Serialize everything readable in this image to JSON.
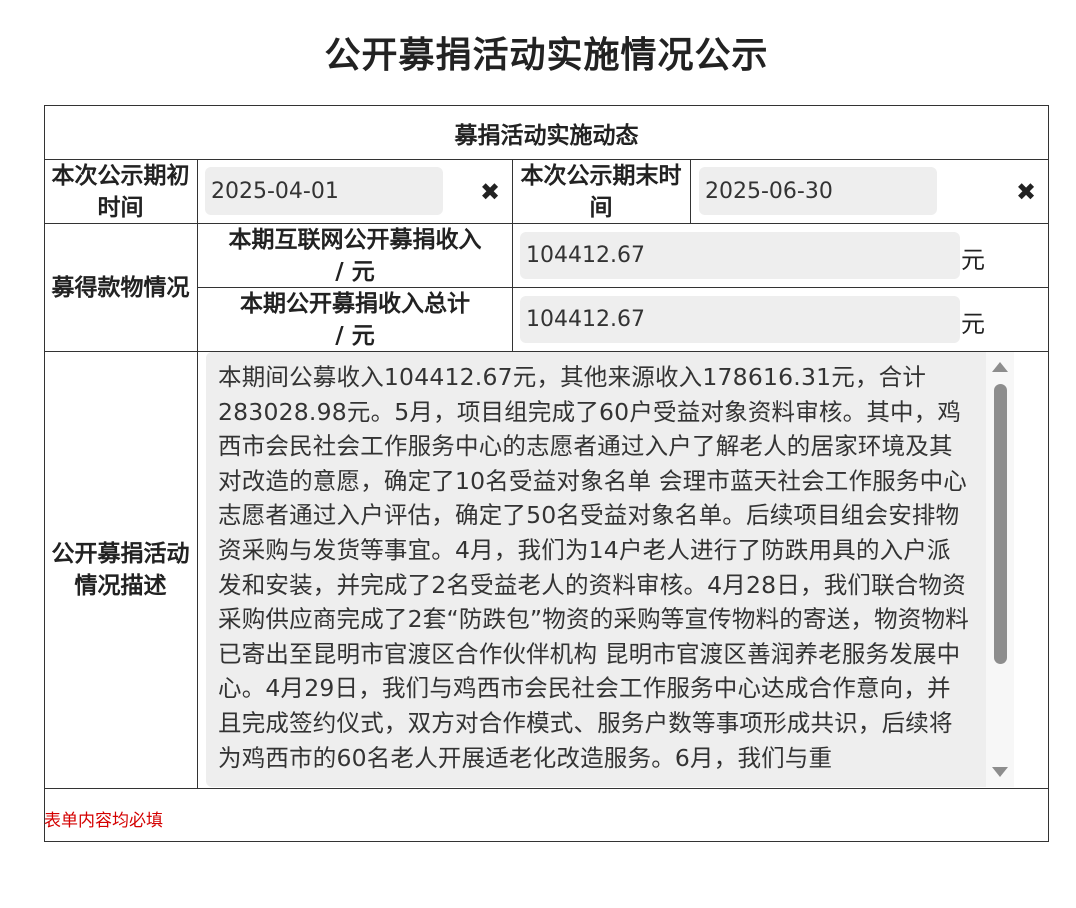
{
  "page": {
    "title": "公开募捐活动实施情况公示"
  },
  "section": {
    "header": "募捐活动实施动态"
  },
  "period": {
    "start_label": "本次公示期初时间",
    "start_value": "2025-04-01",
    "end_label": "本次公示期末时间",
    "end_value": "2025-06-30"
  },
  "funds": {
    "group_label": "募得款物情况",
    "internet_label": "本期互联网公开募捐收入 / 元",
    "internet_value": "104412.67",
    "total_label": "本期公开募捐收入总计 / 元",
    "total_value": "104412.67",
    "unit": "元"
  },
  "description": {
    "label": "公开募捐活动情况描述",
    "text": "本期间公募收入104412.67元，其他来源收入178616.31元，合计283028.98元。5月，项目组完成了60户受益对象资料审核。其中，鸡西市会民社会工作服务中心的志愿者通过入户了解老人的居家环境及其对改造的意愿，确定了10名受益对象名单 会理市蓝天社会工作服务中心志愿者通过入户评估，确定了50名受益对象名单。后续项目组会安排物资采购与发货等事宜。4月，我们为14户老人进行了防跌用具的入户派发和安装，并完成了2名受益老人的资料审核。4月28日，我们联合物资采购供应商完成了2套“防跌包”物资的采购等宣传物料的寄送，物资物料已寄出至昆明市官渡区合作伙伴机构 昆明市官渡区善润养老服务发展中心。4月29日，我们与鸡西市会民社会工作服务中心达成合作意向，并且完成签约仪式，双方对合作模式、服务户数等事项形成共识，后续将为鸡西市的60名老人开展适老化改造服务。6月，我们与重"
  },
  "footer": {
    "required_note": "表单内容均必填"
  },
  "icons": {
    "clear": "close-icon"
  }
}
